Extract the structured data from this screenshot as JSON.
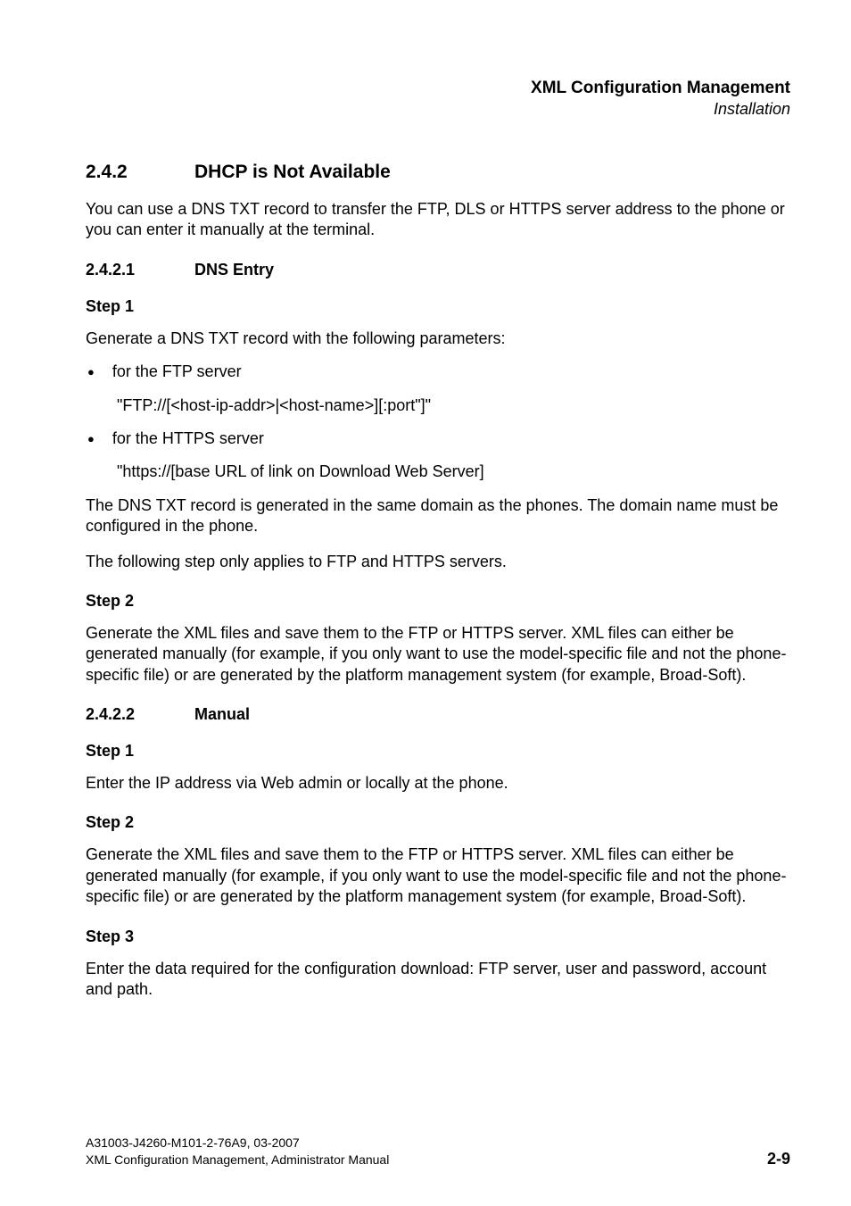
{
  "header": {
    "title": "XML Configuration Management",
    "subtitle": "Installation"
  },
  "section": {
    "number": "2.4.2",
    "title": "DHCP is Not Available",
    "intro": "You can use a DNS TXT record to transfer the FTP, DLS or HTTPS server address to the phone or you can enter it manually at the terminal."
  },
  "subsection1": {
    "number": "2.4.2.1",
    "title": "DNS Entry",
    "step1": {
      "heading": "Step 1",
      "intro": "Generate a DNS TXT record with the following parameters:",
      "bullet1": {
        "label": "for the FTP server",
        "value": "\"FTP://[<host-ip-addr>|<host-name>][:port\"]\""
      },
      "bullet2": {
        "label": "for the HTTPS server",
        "value": "\"https://[base URL of link on Download Web Server]"
      },
      "para1": "The DNS TXT record is generated in the same domain as the phones. The domain name must be configured in the phone.",
      "para2": "The following step only applies to FTP and HTTPS servers."
    },
    "step2": {
      "heading": "Step 2",
      "para": "Generate the XML files and save them to the FTP or HTTPS server. XML files can either be generated manually (for example, if you only want to use the model-specific file and not the phone-specific file) or are generated by the platform management system (for example, Broad-Soft)."
    }
  },
  "subsection2": {
    "number": "2.4.2.2",
    "title": "Manual",
    "step1": {
      "heading": "Step 1",
      "para": "Enter the IP address via Web admin or locally at the phone."
    },
    "step2": {
      "heading": "Step 2",
      "para": "Generate the XML files and save them to the FTP or HTTPS server.  XML files can either be generated manually (for example, if you only want to use the model-specific file and not the phone-specific file) or are generated by the platform management system (for example, Broad-Soft)."
    },
    "step3": {
      "heading": "Step 3",
      "para": "Enter the data required for the configuration download: FTP server, user and password, account and path."
    }
  },
  "footer": {
    "line1": "A31003-J4260-M101-2-76A9, 03-2007",
    "line2": "XML Configuration Management, Administrator Manual",
    "pageNumber": "2-9"
  }
}
